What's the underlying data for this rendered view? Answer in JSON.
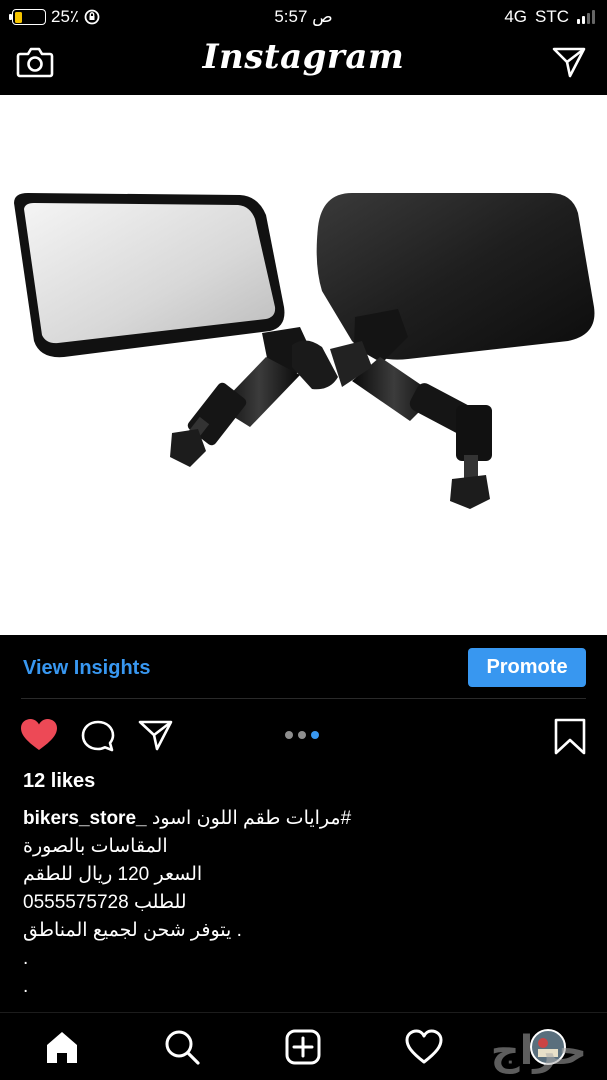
{
  "status_bar": {
    "battery": "25٪",
    "battery_level": 0.25,
    "time": "5:57 ص",
    "network": "4G",
    "carrier": "STC"
  },
  "nav": {
    "logo": "Instagram",
    "left_icon": "camera-icon",
    "right_icon": "direct-message-icon"
  },
  "post": {
    "image_subject": "black motorcycle mirrors pair",
    "carousel": {
      "count": 3,
      "active": 3
    }
  },
  "insights": {
    "view_label": "View Insights",
    "promote_label": "Promote",
    "accent": "#3897f0"
  },
  "engagement": {
    "likes": "12 likes",
    "like_color": "#ed4956"
  },
  "caption": {
    "username": "bikers_store_",
    "lines": [
      "مرايات طقم اللون اسود#",
      "المقاسات بالصورة",
      "السعر 120 ريال للطقم",
      "للطلب 0555575728",
      "يتوفر شحن لجميع المناطق .",
      ".",
      "."
    ]
  },
  "tab_bar": {
    "icons": [
      "home-icon",
      "search-icon",
      "add-post-icon",
      "activity-heart-icon",
      "profile-avatar"
    ],
    "watermark": "حراج"
  }
}
